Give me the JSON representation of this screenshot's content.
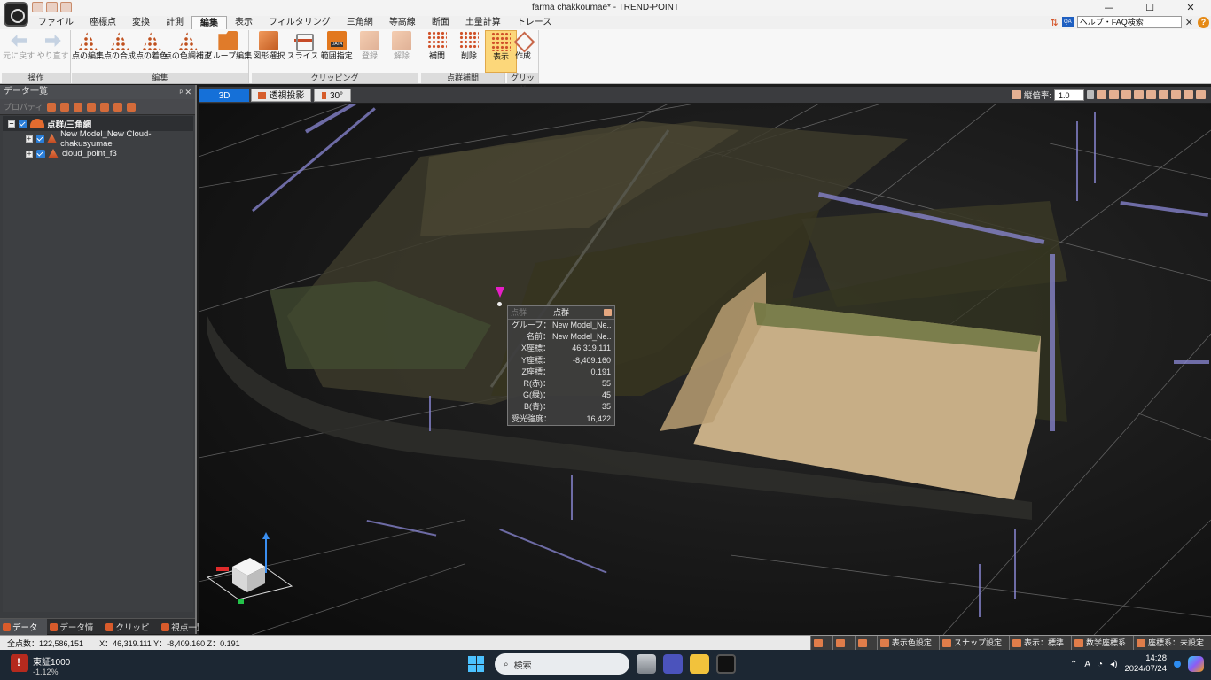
{
  "window": {
    "title": "farma chakkoumae* - TREND-POINT",
    "controls": {
      "minimize": "—",
      "maximize": "☐",
      "close": "✕"
    }
  },
  "menu": {
    "tabs": [
      "ファイル",
      "座標点",
      "変換",
      "計測",
      "編集",
      "表示",
      "フィルタリング",
      "三角網",
      "等高線",
      "断面",
      "土量計算",
      "トレース"
    ],
    "active": "編集",
    "help_search": "ヘルプ・FAQ検索",
    "help_badge": "QA",
    "help_close": "✕",
    "help_q": "?"
  },
  "ribbon": {
    "groups": [
      {
        "label": "操作",
        "buttons": [
          {
            "label": "元に戻す",
            "icon": "undo-icon",
            "disabled": true
          },
          {
            "label": "やり直す",
            "icon": "redo-icon",
            "disabled": true
          }
        ]
      },
      {
        "label": "編集",
        "buttons": [
          {
            "label": "点の編集",
            "icon": "point-edit-icon"
          },
          {
            "label": "点の合成",
            "icon": "point-merge-icon"
          },
          {
            "label": "点の着色",
            "icon": "point-color-icon"
          },
          {
            "label": "点の色調補正",
            "icon": "tone-correction-icon"
          },
          {
            "label": "グループ編集",
            "icon": "group-edit-icon"
          }
        ]
      },
      {
        "label": "クリッピング",
        "buttons": [
          {
            "label": "図形選択",
            "icon": "shape-select-icon"
          },
          {
            "label": "スライス",
            "icon": "slice-icon"
          },
          {
            "label": "範囲指定",
            "icon": "range-data-icon"
          },
          {
            "label": "登録",
            "icon": "register-icon",
            "disabled": true
          },
          {
            "label": "解除",
            "icon": "release-icon",
            "disabled": true
          }
        ]
      },
      {
        "label": "点群補間",
        "buttons": [
          {
            "label": "補間",
            "icon": "interpolate-icon"
          },
          {
            "label": "削除",
            "icon": "delete-icon"
          },
          {
            "label": "表示",
            "icon": "display-icon",
            "selected": true
          }
        ]
      },
      {
        "label": "グリッド",
        "buttons": [
          {
            "label": "作成",
            "icon": "grid-create-icon"
          }
        ]
      }
    ]
  },
  "left_panel": {
    "title": "データ一覧",
    "pins": "ᵖ ✕",
    "toolbar_property": "プロパティ",
    "tree": [
      {
        "label": "点群/三角網",
        "level": 0,
        "root": true
      },
      {
        "label": "New Model_New Cloud-chakusyumae",
        "level": 1
      },
      {
        "label": "cloud_point_f3",
        "level": 1
      }
    ],
    "tabs": [
      "データ...",
      "データ情...",
      "クリッピ...",
      "視点一覧"
    ]
  },
  "viewport": {
    "tabs": [
      "3D",
      "透視投影",
      "30°"
    ],
    "scale_label": "縦倍率:",
    "scale_value": "1.0"
  },
  "info_popup": {
    "ghost": "点群",
    "title": "点群",
    "rows": [
      {
        "k": "グループ：",
        "v": "New Model_Ne..."
      },
      {
        "k": "名前：",
        "v": "New Model_Ne..."
      },
      {
        "k": "X座標：",
        "v": "46,319.111"
      },
      {
        "k": "Y座標：",
        "v": "-8,409.160"
      },
      {
        "k": "Z座標：",
        "v": "0.191"
      },
      {
        "k": "R(赤)：",
        "v": "55"
      },
      {
        "k": "G(緑)：",
        "v": "45"
      },
      {
        "k": "B(青)：",
        "v": "35"
      },
      {
        "k": "受光強度：",
        "v": "16,422"
      }
    ]
  },
  "status_bar": {
    "total_points": "全点数：122,586,151",
    "coords": "X：46,319.111  Y：-8,409.160  Z：0.191",
    "items": [
      "",
      "",
      "",
      "表示色設定",
      "スナップ設定",
      "表示：標準",
      "数学座標系",
      "座標系：未設定"
    ]
  },
  "taskbar": {
    "weather_title": "東証1000",
    "weather_sub": "-1.12%",
    "search_placeholder": "検索",
    "tray_a": "A",
    "time": "14:28",
    "date": "2024/07/24"
  },
  "colors": {
    "accent": "#1570d8",
    "brand": "#e36b2f",
    "selected_button": "#fcd77a"
  }
}
